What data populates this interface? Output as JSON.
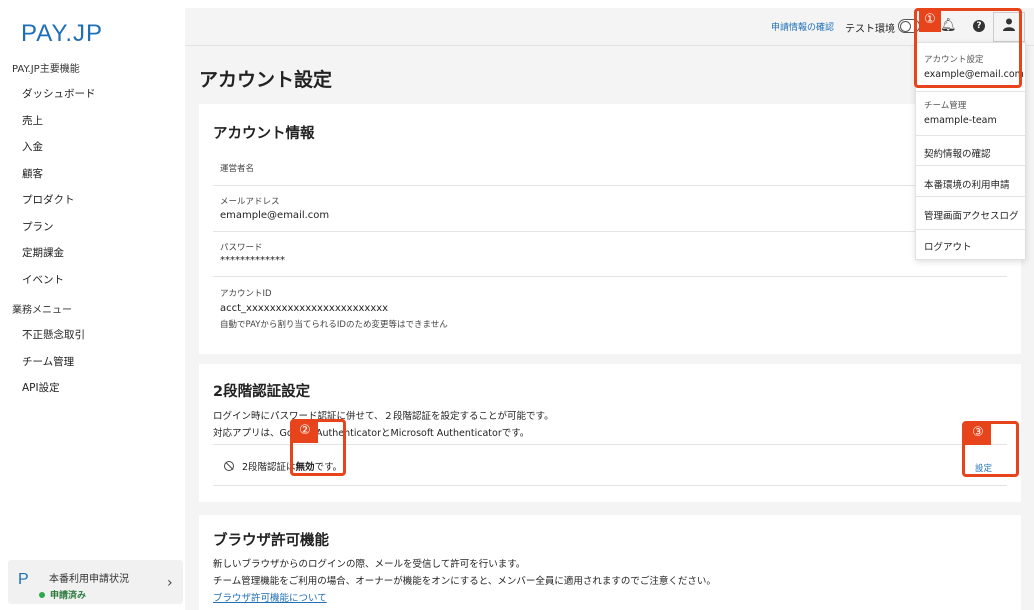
{
  "brand": {
    "logo_main": "PAY",
    "logo_dot": ".",
    "logo_tail": "JP"
  },
  "sidebar": {
    "section_main": "PAY.JP主要機能",
    "main_items": [
      "ダッシュボード",
      "売上",
      "入金",
      "顧客",
      "プロダクト",
      "プラン",
      "定期課金",
      "イベント"
    ],
    "section_business": "業務メニュー",
    "business_items": [
      "不正懸念取引",
      "チーム管理",
      "API設定"
    ],
    "status_card": {
      "title": "本番利用申請状況",
      "badge": "申請済み",
      "status_color": "#2fa84f"
    }
  },
  "topbar": {
    "application_link": "申請情報の確認",
    "env_label": "テスト環境",
    "icons": [
      "bell-icon",
      "help-icon",
      "user-icon"
    ]
  },
  "page": {
    "title": "アカウント設定"
  },
  "account_info": {
    "title": "アカウント情報",
    "operator_label": "運営者名",
    "email_label": "メールアドレス",
    "email_value": "emample@email.com",
    "password_label": "パスワード",
    "password_value": "*************",
    "account_id_label": "アカウントID",
    "account_id_value": "acct_xxxxxxxxxxxxxxxxxxxxxxxx",
    "account_id_note": "自動でPAYから割り当てられるIDのため変更等はできません"
  },
  "two_factor": {
    "title": "2段階認証設定",
    "desc1": "ログイン時にパスワード認証に併せて、２段階認証を設定することが可能です。",
    "desc2": "対応アプリは、Google AuthenticatorとMicrosoft Authenticatorです。",
    "status_prefix": "2段階認証は",
    "status_value": "無効",
    "status_suffix": "です。",
    "setting_link": "設定"
  },
  "browser_permission": {
    "title": "ブラウザ許可機能",
    "desc1": "新しいブラウザからのログインの際、メールを受信して許可を行います。",
    "desc2": "チーム管理機能をご利用の場合、オーナーが機能をオンにすると、メンバー全員に適用されますのでご注意ください。",
    "link": "ブラウザ許可機能について"
  },
  "dropdown": {
    "account_label": "アカウント設定",
    "account_email": "example@email.com",
    "team_label": "チーム管理",
    "team_name": "emample-team",
    "items": [
      "契約情報の確認",
      "本番環境の利用申請",
      "管理画面アクセスログ",
      "ログアウト"
    ]
  },
  "annotations": {
    "one": "①",
    "two": "②",
    "three": "③",
    "color": "#e8441c"
  }
}
